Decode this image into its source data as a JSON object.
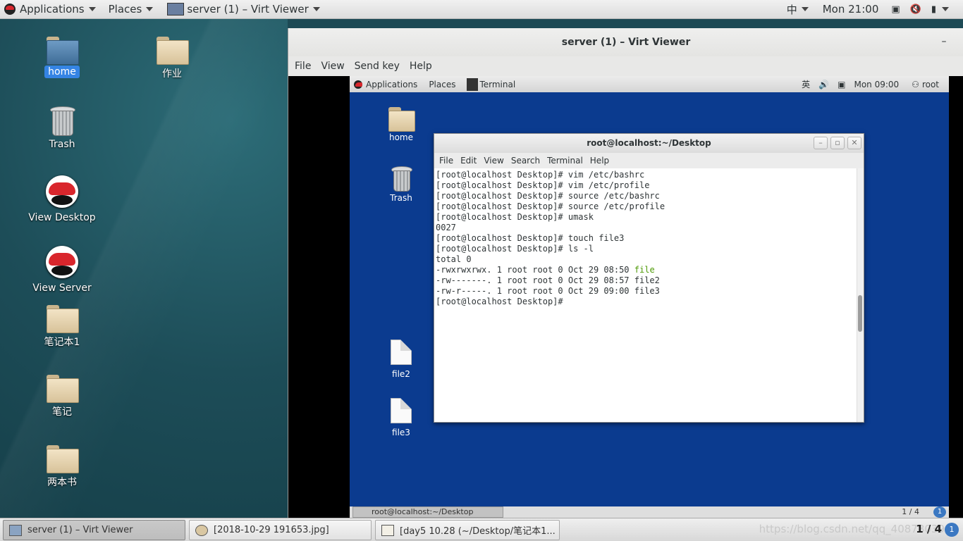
{
  "host_top_bar": {
    "applications": "Applications",
    "places": "Places",
    "active_window": "server (1) – Virt Viewer",
    "input_method": "中",
    "clock": "Mon 21:00"
  },
  "desktop_icons": [
    {
      "label": "home",
      "kind": "home-folder"
    },
    {
      "label": "作业",
      "kind": "folder"
    },
    {
      "label": "Trash",
      "kind": "trash"
    },
    {
      "label": "View Desktop",
      "kind": "redhat"
    },
    {
      "label": "View Server",
      "kind": "redhat"
    },
    {
      "label": "笔记本1",
      "kind": "folder"
    },
    {
      "label": "笔记",
      "kind": "folder"
    },
    {
      "label": "两本书",
      "kind": "folder"
    }
  ],
  "virt_viewer": {
    "title": "server (1) – Virt Viewer",
    "minimize": "–",
    "menu": [
      "File",
      "View",
      "Send key",
      "Help"
    ]
  },
  "guest": {
    "top_bar": {
      "applications": "Applications",
      "places": "Places",
      "task": "Terminal",
      "input_method": "英",
      "clock": "Mon 09:00",
      "user": "root"
    },
    "icons": [
      {
        "label": "home"
      },
      {
        "label": "Trash"
      },
      {
        "label": "file2"
      },
      {
        "label": "file3"
      }
    ],
    "terminal": {
      "title": "root@localhost:~/Desktop",
      "menu": [
        "File",
        "Edit",
        "View",
        "Search",
        "Terminal",
        "Help"
      ],
      "lines": [
        "[root@localhost Desktop]# vim /etc/bashrc",
        "[root@localhost Desktop]# vim /etc/profile",
        "[root@localhost Desktop]# source /etc/bashrc",
        "[root@localhost Desktop]# source /etc/profile",
        "[root@localhost Desktop]# umask",
        "0027",
        "[root@localhost Desktop]# touch file3",
        "[root@localhost Desktop]# ls -l",
        "total 0",
        "-rwxrwxrwx. 1 root root 0 Oct 29 08:50 ",
        "-rw-------. 1 root root 0 Oct 29 08:57 file2",
        "-rw-r-----. 1 root root 0 Oct 29 09:00 file3",
        "[root@localhost Desktop]# "
      ],
      "green_filename": "file"
    },
    "bottom_bar": {
      "task": "root@localhost:~/Desktop",
      "pager": "1 / 4",
      "workspace": "1"
    }
  },
  "host_bottom_bar": {
    "tasks": [
      "server (1) – Virt Viewer",
      "[2018-10-29 191653.jpg]",
      "[day5 10.28 (~/Desktop/笔记本1..."
    ],
    "watermark": "https://blog.csdn.net/qq_40878039",
    "pager": "1 / 4",
    "workspace": "1"
  },
  "colors": {
    "desktop_bg": "#1d4a55",
    "guest_bg": "#0b3b8f",
    "selection": "#3584e4",
    "terminal_green": "#4e9a06"
  }
}
